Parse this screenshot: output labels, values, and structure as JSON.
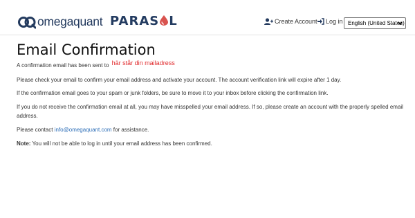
{
  "header": {
    "brand_text": "omegaquant",
    "product_pre": "PARAS",
    "product_post": "L",
    "create_account": "Create Account",
    "login": "Log in",
    "language": "English (United States)",
    "icons": {
      "create": "user-plus-icon",
      "login": "sign-in-icon",
      "caret": "chevron-down-icon"
    },
    "colors": {
      "brand": "#233a5e",
      "drop": "#d9534f"
    }
  },
  "main": {
    "title": "Email Confirmation",
    "sent_to_prefix": "A confirmation email has been sent to",
    "sent_to_email": "här står din mailadress",
    "para_check": "Please check your email to confirm your email address and activate your account.  The account verification link will expire after 1 day.",
    "para_spam": "If the confirmation email goes to your spam or junk folders, be sure to move it to your inbox before clicking the confirmation link.",
    "para_not_received": "If you do not receive the confirmation email at all, you may have misspelled your email address. If so, please create an account with the properly spelled email address.",
    "contact_prefix": "Please contact",
    "contact_email": "info@omegaquant.com",
    "contact_suffix": "for assistance.",
    "note_label": "Note:",
    "note_text": "You will not be able to log in until your email address has been confirmed."
  }
}
